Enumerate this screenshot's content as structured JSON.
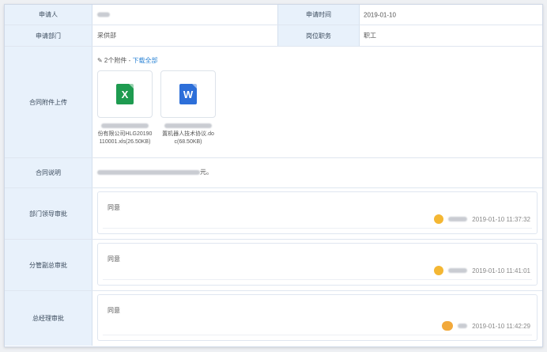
{
  "rows": {
    "applicant_label": "申请人",
    "apply_time_label": "申请时间",
    "apply_time_value": "2019-01-10",
    "dept_label": "申请部门",
    "dept_value": "采供部",
    "position_label": "岗位职务",
    "position_value": "职工",
    "attach_label": "合同附件上传",
    "attach_summary": "✎ 2个附件 - ",
    "attach_download": "下载全部",
    "contract_desc_label": "合同说明",
    "contract_desc_tail": "元。",
    "dept_leader_label": "部门领导审批",
    "deputy_gm_label": "分管副总审批",
    "gm_label": "总经理审批"
  },
  "files": [
    {
      "type": "xls",
      "icon_letter": "X",
      "name_line1": "份有限公司HLG20190",
      "name_line2": "110001.xls(26.50KB)"
    },
    {
      "type": "doc",
      "icon_letter": "W",
      "name_line1": "置机器人技术协议.do",
      "name_line2": "c(68.50KB)"
    }
  ],
  "approvals": [
    {
      "opinion": "同意",
      "time": "2019-01-10 11:37:32"
    },
    {
      "opinion": "同意",
      "time": "2019-01-10 11:41:01"
    },
    {
      "opinion": "同意",
      "time": "2019-01-10 11:42:29"
    }
  ]
}
